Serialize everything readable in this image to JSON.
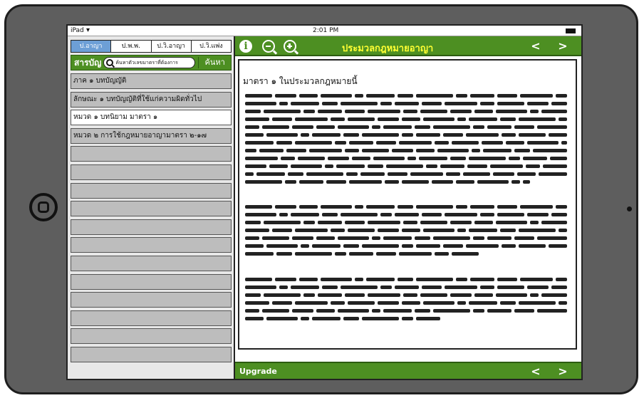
{
  "status_bar": {
    "carrier": "iPad",
    "time": "2:01 PM"
  },
  "tabs": [
    {
      "label": "ป.อาญา",
      "active": true
    },
    {
      "label": "ป.พ.พ.",
      "active": false
    },
    {
      "label": "ป.วิ.อาญา",
      "active": false
    },
    {
      "label": "ป.วิ.แพ่ง",
      "active": false
    }
  ],
  "toc": {
    "label": "สารบัญ",
    "search_placeholder": "ค้นหาตัวเลขมาตราที่ต้องการ",
    "search_button": "ค้นหา"
  },
  "sections": [
    {
      "label": "ภาค ๑ บทบัญญัติ",
      "selected": false
    },
    {
      "label": "ลักษณะ ๑ บทบัญญัติที่ใช้แก่ความผิดทั่วไป",
      "selected": false
    },
    {
      "label": "หมวด ๑ บทนิยาม มาตรา ๑",
      "selected": true
    },
    {
      "label": "หมวด ๒ การใช้กฎหมายอาญามาตรา ๒-๑๗",
      "selected": false
    },
    {
      "label": "",
      "selected": false
    },
    {
      "label": "",
      "selected": false
    },
    {
      "label": "",
      "selected": false
    },
    {
      "label": "",
      "selected": false
    },
    {
      "label": "",
      "selected": false
    },
    {
      "label": "",
      "selected": false
    },
    {
      "label": "",
      "selected": false
    },
    {
      "label": "",
      "selected": false
    },
    {
      "label": "",
      "selected": false
    },
    {
      "label": "",
      "selected": false
    },
    {
      "label": "",
      "selected": false
    },
    {
      "label": "",
      "selected": false
    }
  ],
  "header": {
    "title": "ประมวลกฎหมายอาญา",
    "prev": "<",
    "next": ">",
    "icons": [
      "info-icon",
      "zoom-out-icon",
      "zoom-in-icon"
    ]
  },
  "article": {
    "title": "มาตรา ๑ ในประมวลกฎหมายนี้"
  },
  "footer": {
    "upgrade_label": "Upgrade",
    "prev": "<",
    "next": ">"
  },
  "colors": {
    "accent_green": "#4d8f22",
    "title_yellow": "#ffff33",
    "active_tab_blue": "#6d9fd6",
    "list_gray": "#bdbdbd"
  }
}
